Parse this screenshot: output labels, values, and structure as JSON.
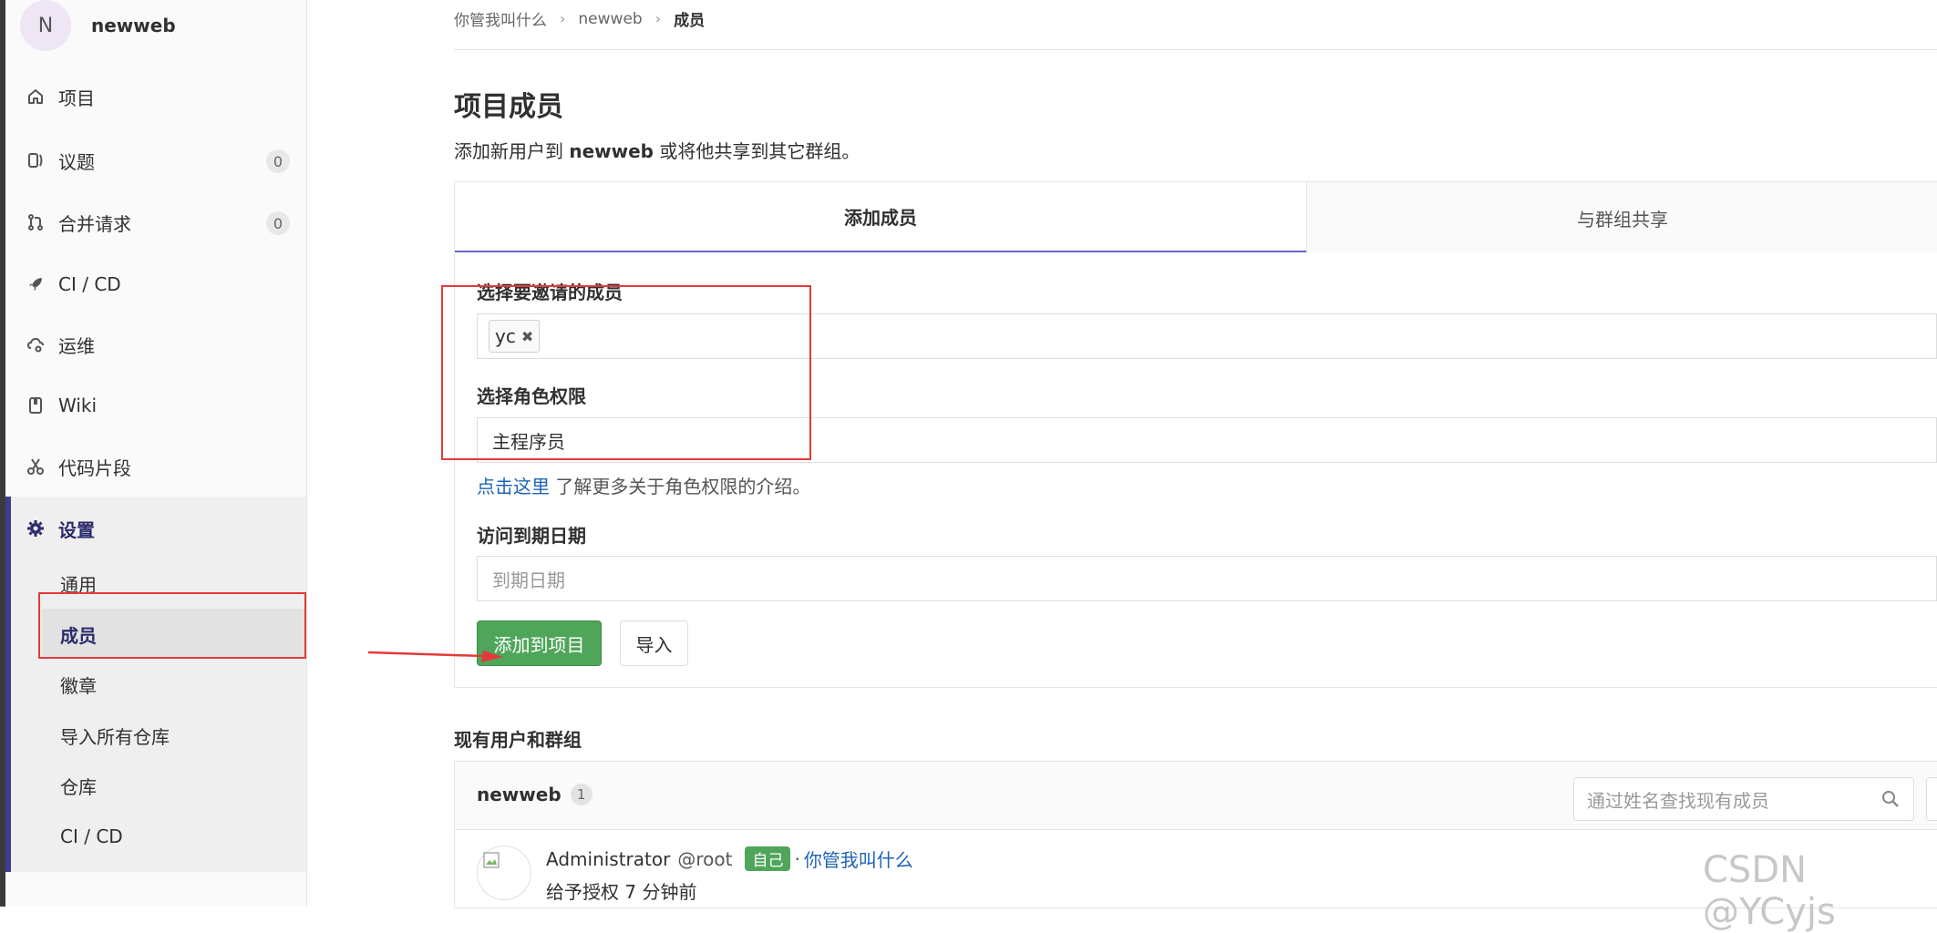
{
  "sidebar": {
    "avatar_letter": "N",
    "project_name": "newweb",
    "items": [
      {
        "label": "项目",
        "icon": "home-icon"
      },
      {
        "label": "议题",
        "icon": "issues-icon",
        "count": "0"
      },
      {
        "label": "合并请求",
        "icon": "merge-request-icon",
        "count": "0"
      },
      {
        "label": "CI / CD",
        "icon": "rocket-icon"
      },
      {
        "label": "运维",
        "icon": "cloud-gear-icon"
      },
      {
        "label": "Wiki",
        "icon": "book-icon"
      },
      {
        "label": "代码片段",
        "icon": "scissors-icon"
      },
      {
        "label": "设置",
        "icon": "gear-icon"
      }
    ],
    "settings_sub": [
      "通用",
      "成员",
      "徽章",
      "导入所有仓库",
      "仓库",
      "CI / CD"
    ]
  },
  "breadcrumb": [
    "你管我叫什么",
    "newweb",
    "成员"
  ],
  "page": {
    "title": "项目成员",
    "subtitle_pre": "添加新用户到 ",
    "subtitle_project": "newweb",
    "subtitle_post": " 或将他共享到其它群组。"
  },
  "tabs": [
    "添加成员",
    "与群组共享"
  ],
  "form": {
    "invite_label": "选择要邀请的成员",
    "invite_token": "yc",
    "role_label": "选择角色权限",
    "role_value": "主程序员",
    "help_link": "点击这里",
    "help_text": " 了解更多关于角色权限的介绍。",
    "expiry_label": "访问到期日期",
    "expiry_placeholder": "到期日期",
    "add_button": "添加到项目",
    "import_button": "导入"
  },
  "members": {
    "section_title": "现有用户和群组",
    "group_name": "newweb",
    "group_count": "1",
    "search_placeholder": "通过姓名查找现有成员",
    "rows": [
      {
        "name": "Administrator",
        "username": "@root",
        "badge": "自己",
        "dot": "·",
        "link": "你管我叫什么",
        "granted": "给予授权 7 分钟前"
      }
    ]
  },
  "watermark": "CSDN @YCyjs",
  "colors": {
    "accent_tab": "#6666c4",
    "success": "#4fa65a",
    "link": "#1f64b5",
    "annotation": "#e23b3b"
  }
}
